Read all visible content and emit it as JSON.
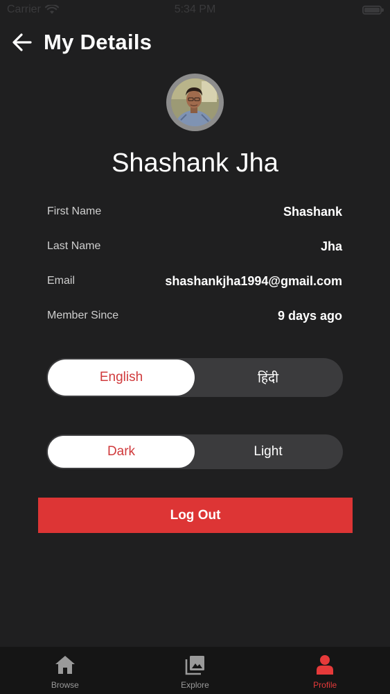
{
  "status_bar": {
    "carrier": "Carrier",
    "time": "5:34 PM"
  },
  "header": {
    "title": "My Details"
  },
  "profile": {
    "full_name": "Shashank Jha"
  },
  "details": [
    {
      "label": "First Name",
      "value": "Shashank"
    },
    {
      "label": "Last Name",
      "value": "Jha"
    },
    {
      "label": "Email",
      "value": "shashankjha1994@gmail.com"
    },
    {
      "label": "Member Since",
      "value": "9 days ago"
    }
  ],
  "language_toggle": {
    "options": [
      "English",
      "हिंदी"
    ],
    "selected": "English"
  },
  "theme_toggle": {
    "options": [
      "Dark",
      "Light"
    ],
    "selected": "Dark"
  },
  "logout": {
    "label": "Log Out"
  },
  "tab_bar": {
    "items": [
      {
        "label": "Browse",
        "icon": "home-icon"
      },
      {
        "label": "Explore",
        "icon": "gallery-icon"
      },
      {
        "label": "Profile",
        "icon": "person-icon"
      }
    ],
    "active": "Profile"
  },
  "colors": {
    "background": "#1f1f20",
    "accent": "#dd3535",
    "toggle_track": "#3b3b3d",
    "tab_bar": "#151515"
  }
}
